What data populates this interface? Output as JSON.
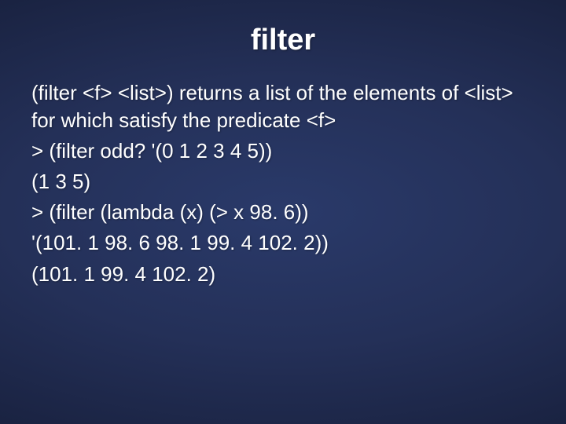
{
  "title": "filter",
  "description": "(filter <f> <list>) returns a list of the elements of <list> for which satisfy the predicate <f>",
  "lines": {
    "l1": "> (filter odd? '(0 1 2 3 4 5))",
    "l2": "(1 3 5)",
    "l3": "> (filter (lambda (x) (> x 98. 6))",
    "l4": "'(101. 1 98. 6 98. 1 99. 4 102. 2))",
    "l5": "(101. 1 99. 4 102. 2)"
  }
}
